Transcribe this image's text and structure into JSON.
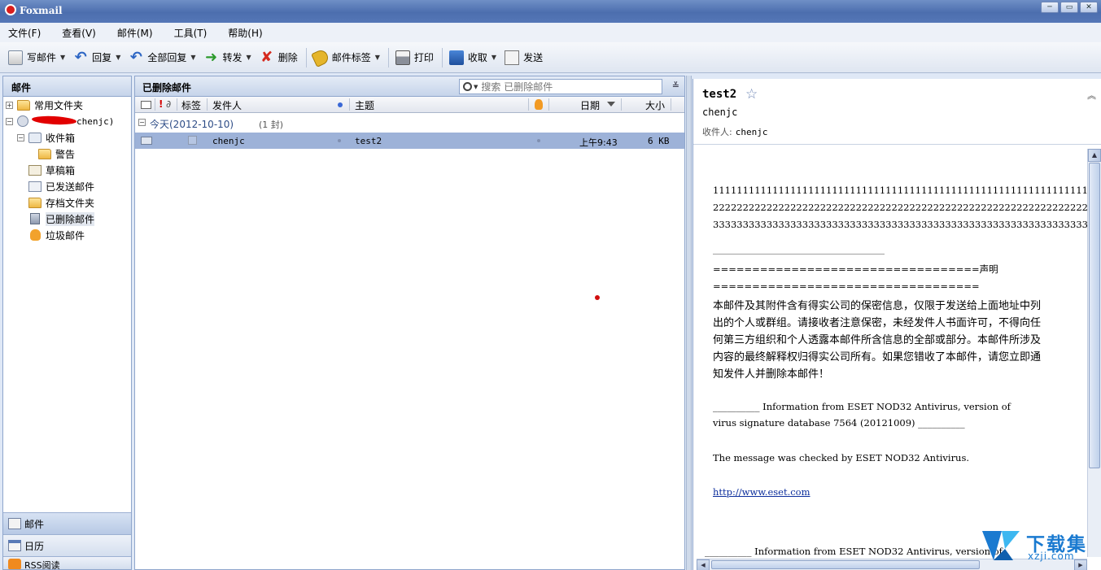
{
  "window": {
    "title": "Foxmail",
    "controls": [
      "─",
      "▭",
      "✕"
    ]
  },
  "menu": [
    "文件(F)",
    "查看(V)",
    "邮件(M)",
    "工具(T)",
    "帮助(H)"
  ],
  "toolbar": {
    "compose": "写邮件",
    "reply": "回复",
    "reply_all": "全部回复",
    "forward": "转发",
    "delete": "删除",
    "tags": "邮件标签",
    "print": "打印",
    "receive": "收取",
    "send": "发送"
  },
  "left": {
    "header": "邮件",
    "tree": {
      "common_folder": "常用文件夹",
      "account": "chenjc)",
      "inbox": "收件箱",
      "alert": "警告",
      "drafts": "草稿箱",
      "sent": "已发送邮件",
      "archive": "存档文件夹",
      "deleted": "已删除邮件",
      "spam": "垃圾邮件"
    },
    "nav": {
      "mail": "邮件",
      "calendar": "日历",
      "rss": "RSS阅读"
    }
  },
  "list": {
    "title": "已删除邮件",
    "search_placeholder": "搜索 已删除邮件",
    "columns": {
      "tag": "标签",
      "sender": "发件人",
      "subject": "主题",
      "date": "日期",
      "size": "大小"
    },
    "group": {
      "title": "今天(2012-10-10)",
      "count": "(1 封)"
    },
    "rows": [
      {
        "sender": "chenjc",
        "subject": "test2",
        "date": "上午9:43",
        "size": "6 KB"
      }
    ]
  },
  "message": {
    "subject": "test2",
    "from": "chenjc",
    "to_label": "收件人:",
    "to": "chenjc",
    "body": {
      "line1": "11111111111111111111111111111111111111111111111111111111111111111111111111",
      "line2": "22222222222222222222222222222222222222222222222222222222222222222222222222",
      "line3": "33333333333333333333333333333333333333333333333333333333333333333333333333",
      "disclaimer_title": "==================================声明",
      "disclaimer_rule": "==================================",
      "disclaimer": [
        "本邮件及其附件含有得实公司的保密信息，仅限于发送给上面地址中列",
        "出的个人或群组。请接收者注意保密，未经发件人书面许可，不得向任",
        "何第三方组织和个人透露本邮件所含信息的全部或部分。本邮件所涉及",
        "内容的最终解释权归得实公司所有。如果您错收了本邮件，请您立即通",
        "知发件人并删除本邮件！"
      ],
      "eset1a": "__________ Information from ESET NOD32 Antivirus, version of",
      "eset1b": "virus signature database 7564 (20121009) __________",
      "eset_checked": "The message was checked by ESET NOD32 Antivirus.",
      "eset_link": "http://www.eset.com",
      "eset2": "__________ Information from ESET NOD32 Antivirus, version of"
    }
  },
  "watermark": {
    "title": "下载集",
    "sub": "xzji.com"
  }
}
